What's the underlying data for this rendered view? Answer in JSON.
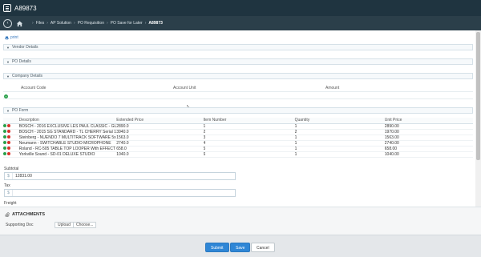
{
  "window": {
    "title": "A89873"
  },
  "breadcrumb": {
    "items": [
      "Files",
      "AP Solution",
      "PO Requisition",
      "PO Save for Later"
    ],
    "current": "A89873"
  },
  "toolbar": {
    "print_label": "print"
  },
  "sections": {
    "vendor": "Vendor Details",
    "po": "PO Details",
    "company": "Company Details",
    "po_form": "PO Form"
  },
  "accounts": {
    "columns": [
      "Account Code",
      "Account Unit",
      "Amount"
    ]
  },
  "po_form": {
    "columns": [
      "Description",
      "Extended Price",
      "Item Number",
      "Quantity",
      "Unit Price"
    ],
    "rows": [
      {
        "description": "BOSCH - 2016 EXCLUSIVE LES PAUL CLASSIC - GL",
        "extended": "2890.0",
        "item": "1",
        "qty": "1",
        "unit": "2890.00"
      },
      {
        "description": "BOSCH - 2015 SG STANDARD - TL CHERRY Serial 1",
        "extended": "3940.0",
        "item": "2",
        "qty": "2",
        "unit": "1970.00"
      },
      {
        "description": "Steinberg - NUENDO 7 MULTITRACK SOFTWARE 5x",
        "extended": "1563.0",
        "item": "3",
        "qty": "1",
        "unit": "1563.00"
      },
      {
        "description": "Neumann - SWITCHABLE STUDIO MICROPHONE",
        "extended": "2740.0",
        "item": "4",
        "qty": "1",
        "unit": "2740.00"
      },
      {
        "description": "Roland - RC-505 TABLE TOP LOOPER With EFFECT",
        "extended": "658.0",
        "item": "5",
        "qty": "1",
        "unit": "658.00"
      },
      {
        "description": "Yorkville Sound - SD-01 DELUXE STUDIO",
        "extended": "1040.0",
        "item": "6",
        "qty": "1",
        "unit": "1040.00"
      }
    ]
  },
  "totals": {
    "subtotal_label": "Subtotal",
    "subtotal_value": "12831.00",
    "tax_label": "Tax",
    "tax_value": "",
    "freight_label": "Freight",
    "currency_symbol": "$"
  },
  "attachments": {
    "title": "ATTACHMENTS",
    "supporting_doc_label": "Supporting Doc",
    "upload_label": "Upload",
    "choose_label": "Choose..."
  },
  "footer": {
    "submit_label": "Submit",
    "save_label": "Save",
    "cancel_label": "Cancel"
  },
  "colors": {
    "titlebar": "#1f3440",
    "breadcrumb_bar": "#2b3f4a",
    "primary_button": "#2f86d6",
    "add_green": "#2aa04a",
    "delete_red": "#d9322b"
  }
}
